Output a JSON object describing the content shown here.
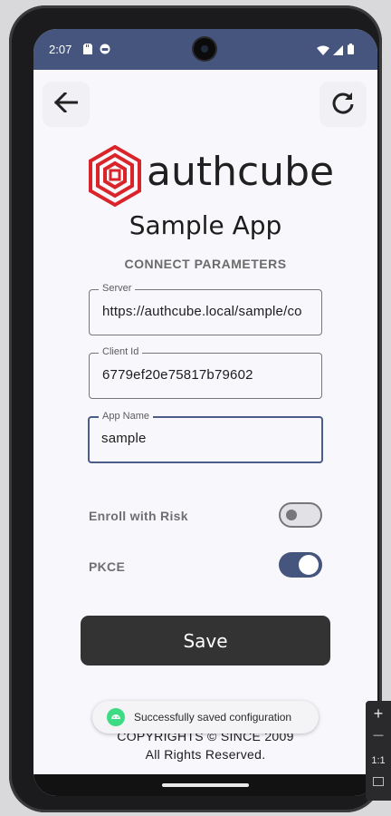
{
  "status_bar": {
    "time": "2:07",
    "icons": [
      "sd-card-icon",
      "android-status-icon",
      "wifi-icon",
      "signal-icon",
      "battery-icon"
    ]
  },
  "toolbar": {
    "back_icon": "arrow-left-icon",
    "refresh_icon": "refresh-icon"
  },
  "brand": {
    "name": "authcube",
    "logo_color": "#d9242a"
  },
  "app_title": "Sample App",
  "section_title": "CONNECT PARAMETERS",
  "form": {
    "server": {
      "label": "Server",
      "value": "https://authcube.local/sample/co"
    },
    "client_id": {
      "label": "Client Id",
      "value": "6779ef20e75817b79602"
    },
    "app_name": {
      "label": "App Name",
      "value": "sample"
    }
  },
  "toggles": {
    "enroll_with_risk": {
      "label": "Enroll with Risk",
      "checked": false
    },
    "pkce": {
      "label": "PKCE",
      "checked": true
    }
  },
  "save_label": "Save",
  "footer": {
    "line1": "COPYRIGHTS © SINCE 2009",
    "line2": "All Rights Reserved."
  },
  "toast": {
    "message": "Successfully saved configuration"
  },
  "side_panel": {
    "zoom_in": "+",
    "zoom_out": "—",
    "ratio": "1:1"
  },
  "colors": {
    "status_bar": "#45557e",
    "accent": "#45557e",
    "button": "#333333",
    "background": "#f8f7fc"
  }
}
